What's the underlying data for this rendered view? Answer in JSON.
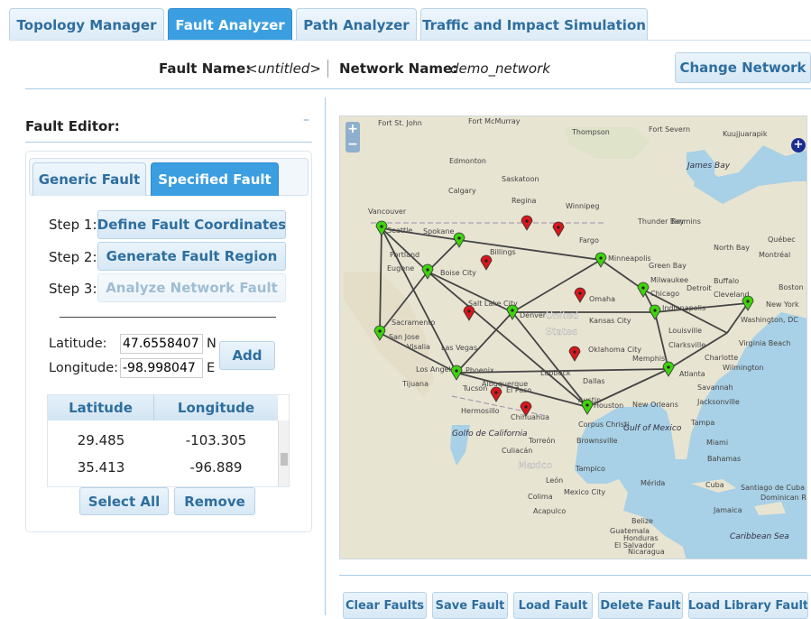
{
  "tabs": [
    {
      "label": "Topology Manager"
    },
    {
      "label": "Fault Analyzer"
    },
    {
      "label": "Path Analyzer"
    },
    {
      "label": "Traffic and Impact Simulation"
    }
  ],
  "header": {
    "fault_name_label": "Fault Name:",
    "fault_name_value": "<untitled>",
    "network_name_label": "Network Name:",
    "network_name_value": "demo_network",
    "change_network": "Change Network"
  },
  "editor": {
    "title": "Fault Editor:",
    "collapse": "–",
    "subtabs": [
      {
        "label": "Generic Fault"
      },
      {
        "label": "Specified Fault"
      }
    ],
    "steps": [
      {
        "label": "Step 1:",
        "button": "Define Fault Coordinates"
      },
      {
        "label": "Step 2:",
        "button": "Generate Fault Region"
      },
      {
        "label": "Step 3:",
        "button": "Analyze Network Fault"
      }
    ],
    "latitude_label": "Latitude:",
    "latitude_value": "47.6558407",
    "latitude_suffix": "N",
    "longitude_label": "Longitude:",
    "longitude_value": "-98.998047",
    "longitude_suffix": "E",
    "add": "Add",
    "table_headers": [
      "Latitude",
      "Longitude"
    ],
    "rows": [
      {
        "lat": "29.485",
        "lon": "-103.305"
      },
      {
        "lat": "35.413",
        "lon": "-96.889"
      }
    ],
    "select_all": "Select All",
    "remove": "Remove"
  },
  "map": {
    "zoom_in": "+",
    "zoom_out": "−",
    "layer_switch": "+",
    "water_color": "#a8d0e6",
    "land_color": "#e8e4d2",
    "node_green": "#3fd20f",
    "node_red": "#d8171c",
    "labels": [
      "Fort St. John",
      "Fort McMurray",
      "Thompson",
      "Fort Severn",
      "Kuujjuarapik",
      "James Bay",
      "Edmonton",
      "Saskatoon",
      "Calgary",
      "Regina",
      "Winnipeg",
      "Vancouver",
      "Seattle",
      "Spokane",
      "Thunder Bay",
      "Timmins",
      "Québec",
      "Portland",
      "Billings",
      "Fargo",
      "North Bay",
      "Montréal",
      "Eugene",
      "Boise City",
      "Minneapolis",
      "Green Bay",
      "Milwaukee",
      "Detroit",
      "Buffalo",
      "Boston",
      "Chicago",
      "Cleveland",
      "New York",
      "Salt Lake City",
      "Omaha",
      "Indianapolis",
      "Washington, DC",
      "Sacramento",
      "Denver",
      "United",
      "States",
      "Kansas City",
      "Louisville",
      "San Jose",
      "Visalia",
      "Las Vegas",
      "Oklahoma City",
      "Clarksville",
      "Virginia Beach",
      "Los Angeles",
      "Phoenix",
      "Albuquerque",
      "Memphis",
      "Charlotte",
      "Wilmington",
      "Tijuana",
      "Tucson",
      "El Paso",
      "Lubbock",
      "Dallas",
      "Atlanta",
      "Savannah",
      "Jacksonville",
      "Hermosillo",
      "Chihuahua",
      "Austin",
      "Houston",
      "New Orleans",
      "Tampa",
      "Golfo de California",
      "Torreón",
      "Corpus Christi",
      "Brownsville",
      "Miami",
      "Culiacán",
      "Gulf of Mexico",
      "Bahamas",
      "Mexico",
      "Tampico",
      "León",
      "Mérida",
      "Cuba",
      "Santiago de Cuba",
      "Colima",
      "Mexico City",
      "Dominican Rep.",
      "Acapulco",
      "Jamaica",
      "Belize",
      "Guatemala",
      "Honduras",
      "El Salvador",
      "Nicaragua",
      "Caribbean Sea"
    ]
  },
  "footer": {
    "buttons": [
      {
        "label": "Clear Faults"
      },
      {
        "label": "Save Fault"
      },
      {
        "label": "Load Fault"
      },
      {
        "label": "Delete Fault"
      },
      {
        "label": "Load Library Fault"
      }
    ]
  }
}
